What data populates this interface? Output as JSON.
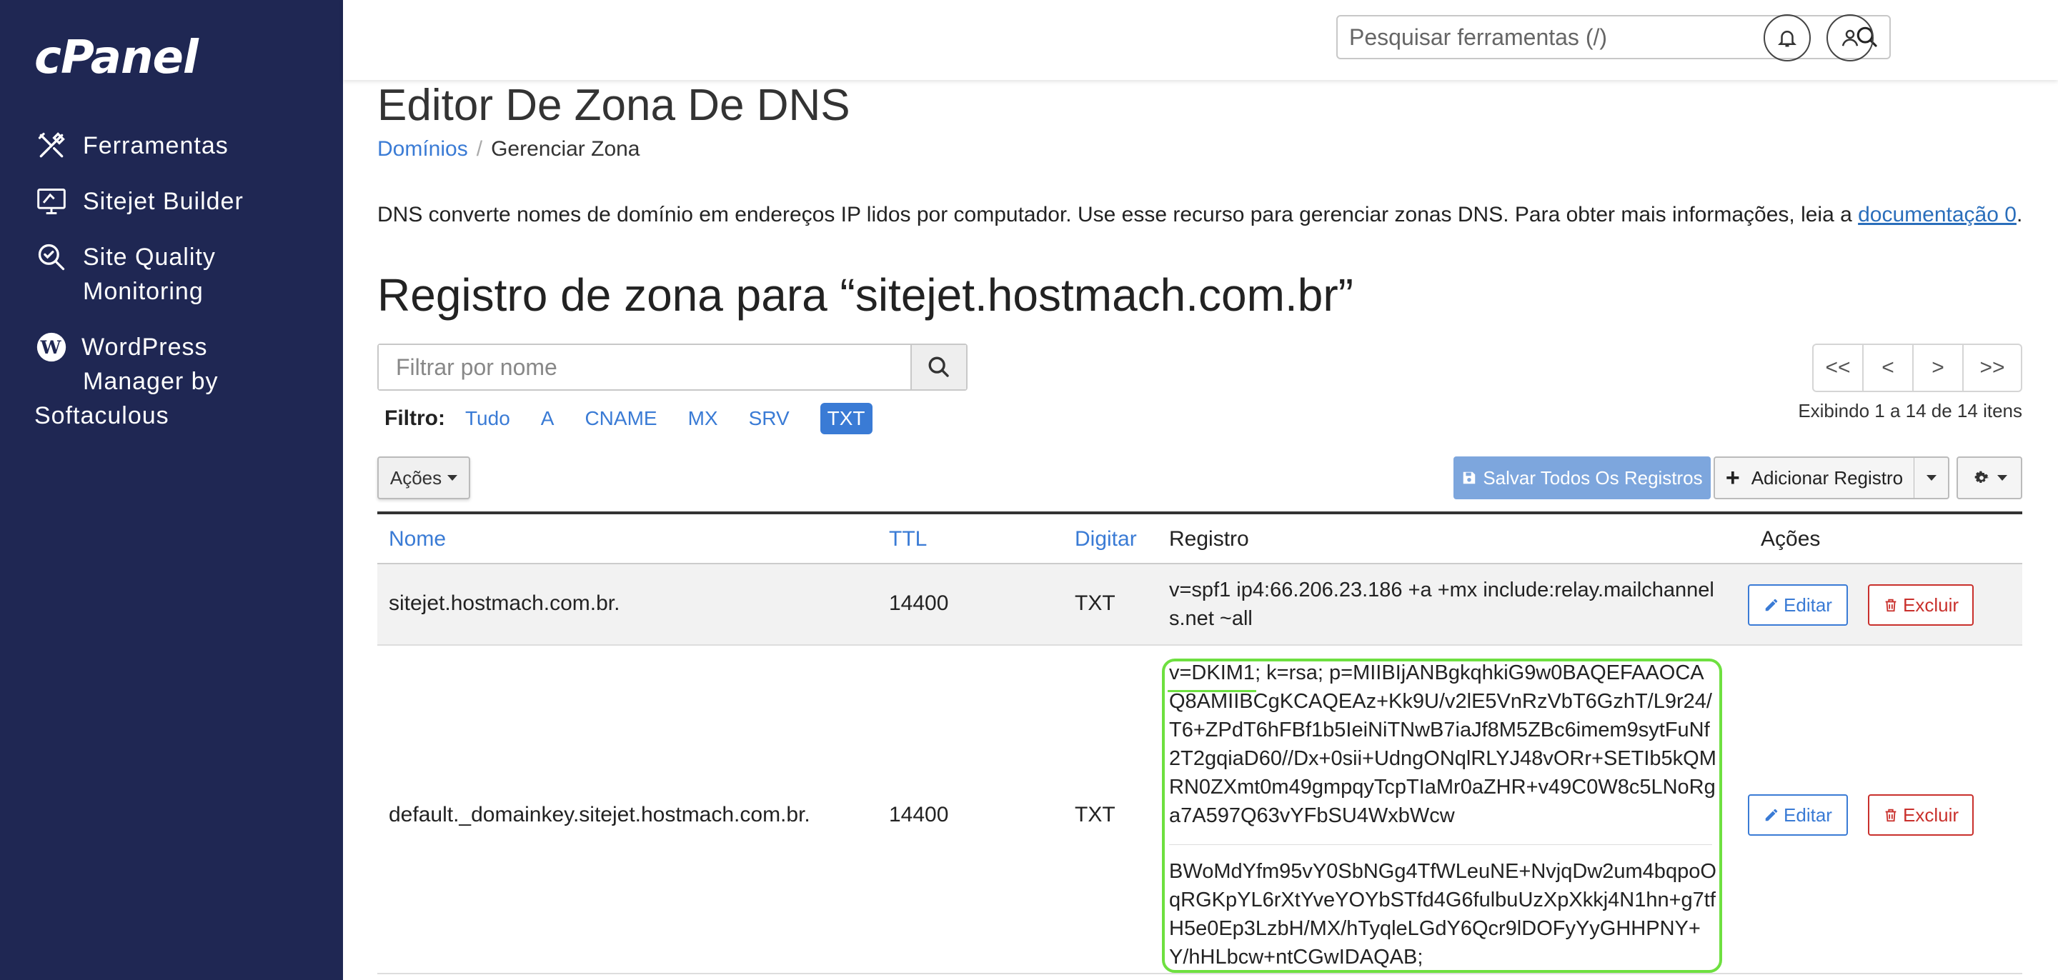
{
  "sidebar": {
    "logo": "cPanel",
    "items": [
      {
        "label": "Ferramentas",
        "icon": "tools-icon"
      },
      {
        "label": "Sitejet Builder",
        "icon": "sitejet-icon"
      },
      {
        "label_line1": "Site Quality",
        "label_line2": "Monitoring",
        "icon": "quality-icon"
      },
      {
        "label_line1": "WordPress",
        "label_line2": "Manager by",
        "label_line3": "Softaculous",
        "icon": "wordpress-icon"
      }
    ]
  },
  "header": {
    "search_placeholder": "Pesquisar ferramentas (/)"
  },
  "page": {
    "title": "Editor De Zona De DNS",
    "breadcrumb": {
      "link": "Domínios",
      "separator": "/",
      "current": "Gerenciar Zona"
    },
    "description": "DNS converte nomes de domínio em endereços IP lidos por computador. Use esse recurso para gerenciar zonas DNS. Para obter mais informações, leia a ",
    "description_link": "documentação 0",
    "description_end": ".",
    "zone_title": "Registro de zona para “sitejet.hostmach.com.br”"
  },
  "filter": {
    "placeholder": "Filtrar por nome",
    "label": "Filtro:",
    "options": [
      "Tudo",
      "A",
      "CNAME",
      "MX",
      "SRV",
      "TXT"
    ],
    "active": "TXT"
  },
  "pager": {
    "first": "<<",
    "prev": "<",
    "next": ">",
    "last": ">>",
    "showing": "Exibindo 1 a 14 de 14 itens"
  },
  "toolbar": {
    "acoes": "Ações",
    "save_all": "Salvar Todos Os Registros",
    "add_record": "Adicionar Registro"
  },
  "table": {
    "headers": {
      "name": "Nome",
      "ttl": "TTL",
      "type": "Digitar",
      "record": "Registro",
      "actions": "Ações"
    },
    "rows": [
      {
        "name": "sitejet.hostmach.com.br.",
        "ttl": "14400",
        "type": "TXT",
        "record": "v=spf1 ip4:66.206.23.186 +a +mx include:relay.mailchannels.net ~all",
        "edit": "Editar",
        "delete": "Excluir"
      },
      {
        "name": "default._domainkey.sitejet.hostmach.com.br.",
        "ttl": "14400",
        "type": "TXT",
        "record_part1": "v=DKIM1; k=rsa; p=MIIBIjANBgkqhkiG9w0BAQEFAAOCAQ8AMIIBCgKCAQEAz+Kk9U/v2lE5VnRzVbT6GzhT/L9r24/T6+ZPdT6hFBf1b5IeiNiTNwB7iaJf8M5ZBc6imem9sytFuNf2T2gqiaD60//Dx+0sii+UdngONqlRLYJ48vORr+SETIb5kQMRN0ZXmt0m49gmpqyTcpTIaMr0aZHR+v49C0W8c5LNoRga7A597Q63vYFbSU4WxbWcw",
        "record_part2": "BWoMdYfm95vY0SbNGg4TfWLeuNE+NvjqDw2um4bqpoOqRGKpYL6rXtYveYOYbSTfd4G6fulbuUzXpXkkj4N1hn+g7tfH5e0Ep3LzbH/MX/hTyqleLGdY6Qcr9lDOFyYyGHHPNY+Y/hHLbcw+ntCGwIDAQAB;",
        "edit": "Editar",
        "delete": "Excluir"
      }
    ]
  },
  "colors": {
    "sidebar_bg": "#1f2753",
    "link": "#3a7bd5",
    "danger": "#c9302c",
    "highlight": "#6ee040"
  }
}
